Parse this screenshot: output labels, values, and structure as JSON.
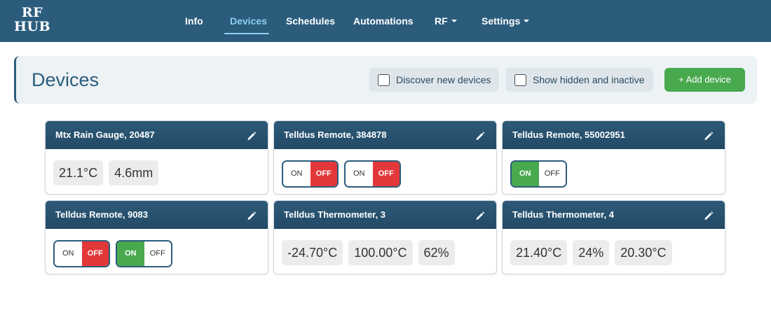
{
  "nav": {
    "logo_line1": "RF",
    "logo_line2": "HUB",
    "items": [
      {
        "label": "Info"
      },
      {
        "label": "Devices"
      },
      {
        "label": "Schedules"
      },
      {
        "label": "Automations"
      },
      {
        "label": "RF"
      },
      {
        "label": "Settings"
      }
    ],
    "active": "Devices"
  },
  "header": {
    "title": "Devices",
    "discover_label": "Discover new devices",
    "show_hidden_label": "Show hidden and inactive",
    "add_label": "+ Add device"
  },
  "devices": [
    {
      "name": "Mtx Rain Gauge, 20487",
      "readings": [
        "21.1°C",
        "4.6mm"
      ]
    },
    {
      "name": "Telldus Remote, 384878",
      "toggles": [
        {
          "on": "ON",
          "off": "OFF",
          "state": "off"
        },
        {
          "on": "ON",
          "off": "OFF",
          "state": "off"
        }
      ]
    },
    {
      "name": "Telldus Remote, 55002951",
      "toggles": [
        {
          "on": "ON",
          "off": "OFF",
          "state": "on"
        }
      ]
    },
    {
      "name": "Telldus Remote, 9083",
      "toggles": [
        {
          "on": "ON",
          "off": "OFF",
          "state": "off"
        },
        {
          "on": "ON",
          "off": "OFF",
          "state": "on"
        }
      ]
    },
    {
      "name": "Telldus Thermometer, 3",
      "readings": [
        "-24.70°C",
        "100.00°C",
        "62%"
      ]
    },
    {
      "name": "Telldus Thermometer, 4",
      "readings": [
        "21.40°C",
        "24%",
        "20.30°C"
      ]
    }
  ],
  "colors": {
    "navbar": "#2b5c7c",
    "nav_active": "#8fd0f0",
    "on_green": "#48a94f",
    "off_red": "#e2383a"
  }
}
